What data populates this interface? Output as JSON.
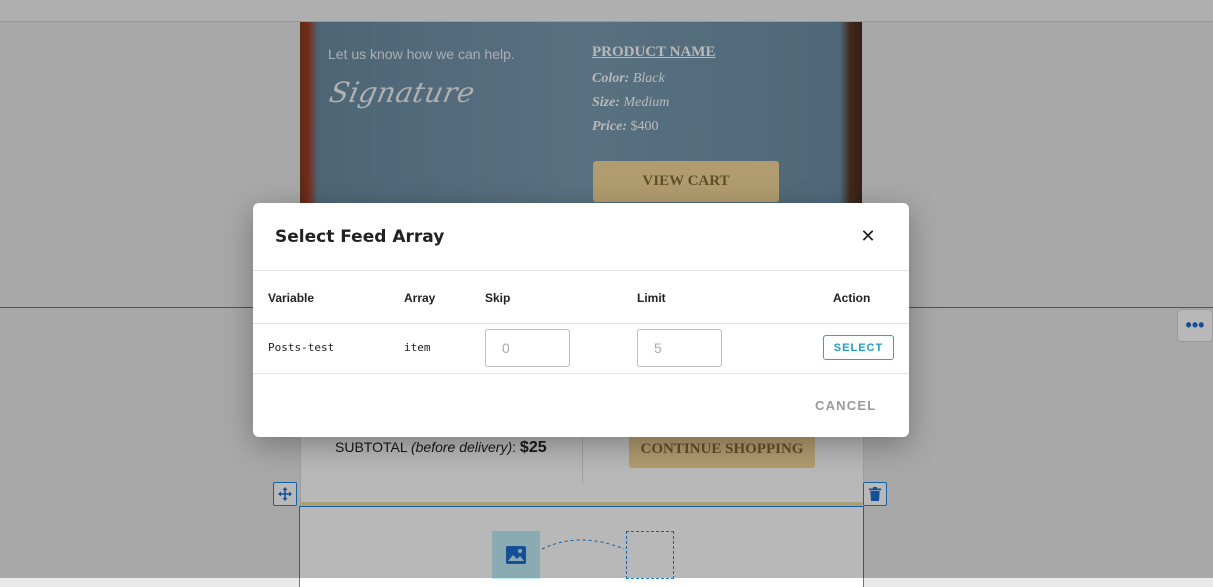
{
  "email": {
    "help_text": "Let us know how we can help.",
    "signature": "Signature",
    "product_name": "PRODUCT NAME",
    "color_label": "Color:",
    "color_value": "Black",
    "size_label": "Size:",
    "size_value": "Medium",
    "price_label": "Price:",
    "price_value": "$400",
    "view_cart": "VIEW CART",
    "subtotal_prefix": "SUBTOTAL",
    "subtotal_note": "(before delivery)",
    "subtotal_value": "$25",
    "continue_shopping": "CONTINUE SHOPPING"
  },
  "icons": {
    "more": "more-horizontal-icon",
    "move": "move-icon",
    "delete": "trash-icon",
    "image": "image-icon",
    "close": "close-icon"
  },
  "modal": {
    "title": "Select Feed Array",
    "columns": {
      "variable": "Variable",
      "array": "Array",
      "skip": "Skip",
      "limit": "Limit",
      "action": "Action"
    },
    "row": {
      "variable": "Posts-test",
      "array": "item",
      "skip_placeholder": "0",
      "limit_placeholder": "5",
      "action_label": "SELECT"
    },
    "cancel_label": "CANCEL"
  },
  "colors": {
    "accent": "#1e88e5",
    "select_button": "#26a6c8",
    "cta_gold": "#f6d99a"
  }
}
